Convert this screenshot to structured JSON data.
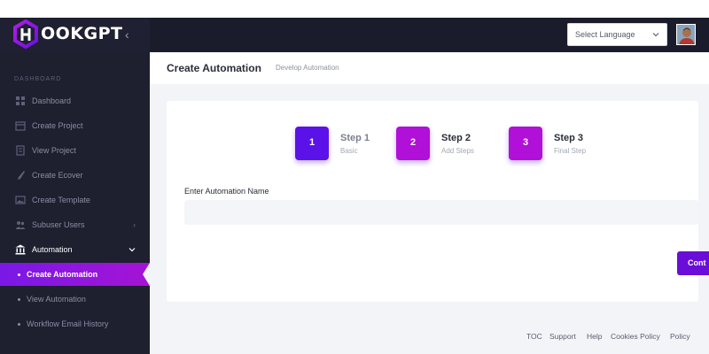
{
  "header": {
    "brand": "OOKGPT",
    "language_select": "Select Language"
  },
  "sidebar": {
    "section_label": "DASHBOARD",
    "items": [
      {
        "label": "Dashboard",
        "icon": "dashboard-icon"
      },
      {
        "label": "Create Project",
        "icon": "calendar-icon"
      },
      {
        "label": "View Project",
        "icon": "view-doc-icon"
      },
      {
        "label": "Create Ecover",
        "icon": "brush-icon"
      },
      {
        "label": "Create Template",
        "icon": "image-icon"
      },
      {
        "label": "Subuser Users",
        "icon": "users-icon"
      },
      {
        "label": "Automation",
        "icon": "bank-icon"
      }
    ],
    "subitems": [
      {
        "label": "Create Automation"
      },
      {
        "label": "View Automation"
      },
      {
        "label": "Workflow Email History"
      }
    ]
  },
  "page": {
    "title": "Create Automation",
    "subtitle": "Develop Automation"
  },
  "steps": [
    {
      "number": "1",
      "title": "Step 1",
      "desc": "Basic"
    },
    {
      "number": "2",
      "title": "Step 2",
      "desc": "Add Steps"
    },
    {
      "number": "3",
      "title": "Step 3",
      "desc": "Final Step"
    }
  ],
  "form": {
    "name_label": "Enter Automation Name",
    "name_value": ""
  },
  "actions": {
    "continue_label": "Cont"
  },
  "footer": {
    "links": [
      "TOC",
      "Support",
      "Help",
      "Cookies Policy",
      "Policy"
    ]
  },
  "colors": {
    "accent": "#6a0dd8",
    "step1": "#5b12e8",
    "step2": "#b010d8",
    "step3": "#b010d8"
  }
}
